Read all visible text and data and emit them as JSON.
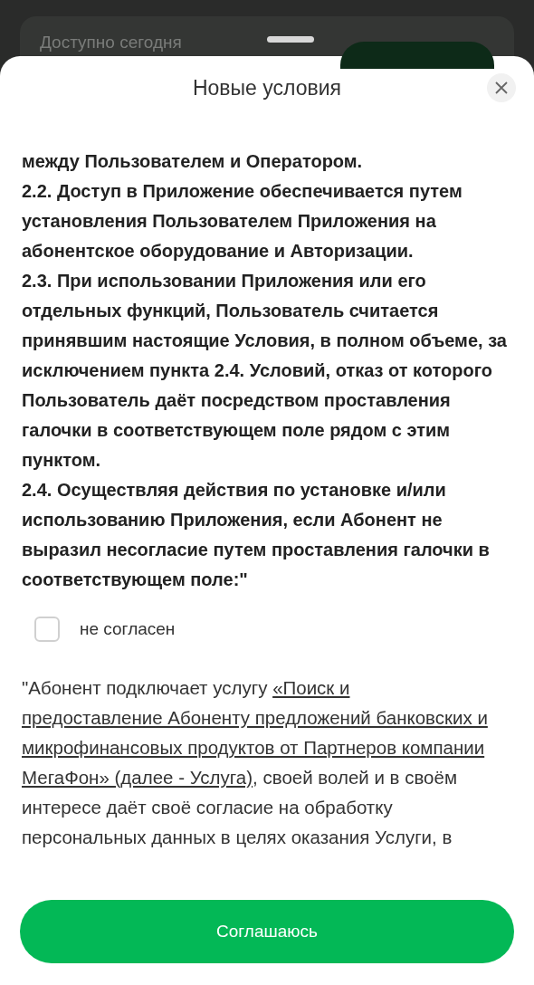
{
  "background": {
    "card_label": "Доступно сегодня"
  },
  "sheet": {
    "title": "Новые условия",
    "terms": [
      "между Пользователем и Оператором.",
      "2.2. Доступ в Приложение обеспечивается путем установления Пользователем Приложения на абонентское оборудование и Авторизации.",
      "2.3. При использовании Приложения или его отдельных функций, Пользователь считается принявшим настоящие Условия, в полном объеме, за исключением пункта 2.4. Условий, отказ от которого Пользователь даёт посредством проставления галочки в соответствующем поле рядом с этим пунктом.",
      "2.4. Осуществляя действия по установке и/или использованию Приложения, если Абонент не выразил несогласие путем проставления галочки в соответствующем поле:\""
    ],
    "checkbox": {
      "label": "не согласен",
      "checked": false
    },
    "consent_lines": [
      [
        {
          "text": "\"Абонент подключает услугу ",
          "link": false
        },
        {
          "text": "«Поиск и",
          "link": true
        }
      ],
      [
        {
          "text": "предоставление Абоненту предложений банковских и",
          "link": true
        }
      ],
      [
        {
          "text": "микрофинансовых продуктов от Партнеров компании",
          "link": true
        }
      ],
      [
        {
          "text": "МегаФон» (далее - Услуга)",
          "link": true
        },
        {
          "text": ", своей волей и в своём",
          "link": false
        }
      ],
      [
        {
          "text": "интересе даёт своё согласие на обработку",
          "link": false
        }
      ],
      [
        {
          "text": "персональных данных в целях оказания Услуги, в",
          "link": false
        }
      ]
    ],
    "button": "Соглашаюсь"
  }
}
